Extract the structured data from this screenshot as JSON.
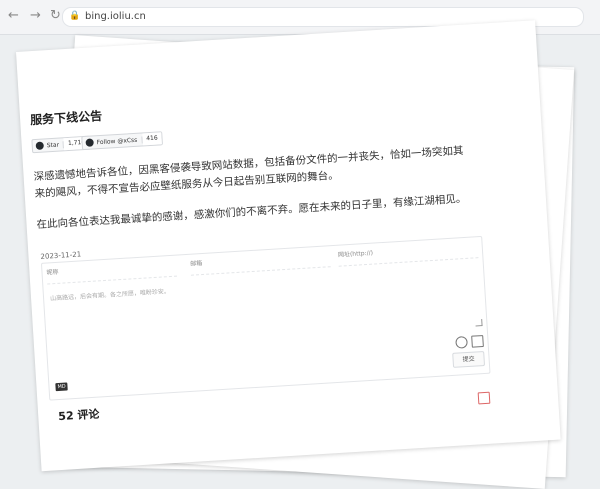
{
  "browser": {
    "url": "bing.ioliu.cn",
    "back_icon": "←",
    "forward_icon": "→",
    "reload_icon": "↻",
    "lock_icon": "🔒"
  },
  "article": {
    "title": "服务下线公告",
    "badges": [
      {
        "label": "Star",
        "count": "1,710"
      },
      {
        "label": "Follow @xCss",
        "count": "416"
      }
    ],
    "paragraphs": [
      "深感遗憾地告诉各位，因黑客侵袭导致网站数据，包括备份文件的一并丧失，恰如一场突如其来的飓风，不得不宣告必应壁纸服务从今日起告别互联网的舞台。",
      "在此向各位表达我最诚挚的感谢，感激你们的不离不弃。愿在未来的日子里，有缘江湖相见。"
    ],
    "date": "2023-11-21"
  },
  "comments": {
    "fields": {
      "nickname": "昵称",
      "email": "邮箱",
      "website": "网址(http://)"
    },
    "placeholder": "山高路远，后会有期。各之所愿，唯盼珍安。",
    "submit_label": "提交",
    "markdown_label": "MD",
    "count_label": "52 评论"
  }
}
